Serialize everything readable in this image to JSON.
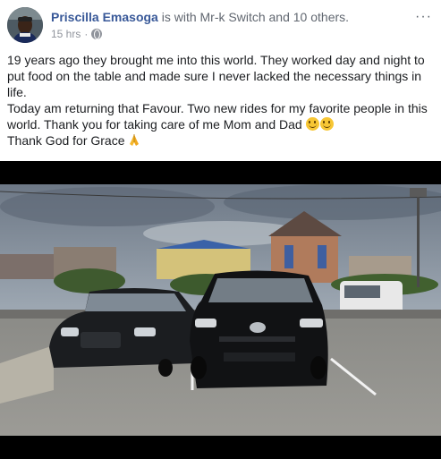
{
  "post": {
    "author": "Priscilla Emasoga",
    "with_text": "is with Mr-k Switch and 10 others.",
    "time": "15 hrs",
    "separator": "·",
    "more_label": "···",
    "text_lines": [
      "19 years ago they brought me into this world. They worked day and night to put food on the table and made sure I never lacked the necessary things in life.",
      "Today am returning that Favour. Two new rides for my favorite people in this world. Thank you for taking care of me Mom and Dad",
      "Thank God for Grace"
    ]
  },
  "icons": {
    "globe": "globe-icon",
    "more": "more-options-icon",
    "smile": "smiling-face-emoji",
    "pray": "folded-hands-emoji"
  },
  "colors": {
    "author_link": "#385898",
    "secondary_text": "#90949c",
    "body_text": "#1c1e21",
    "media_background": "#000000"
  }
}
